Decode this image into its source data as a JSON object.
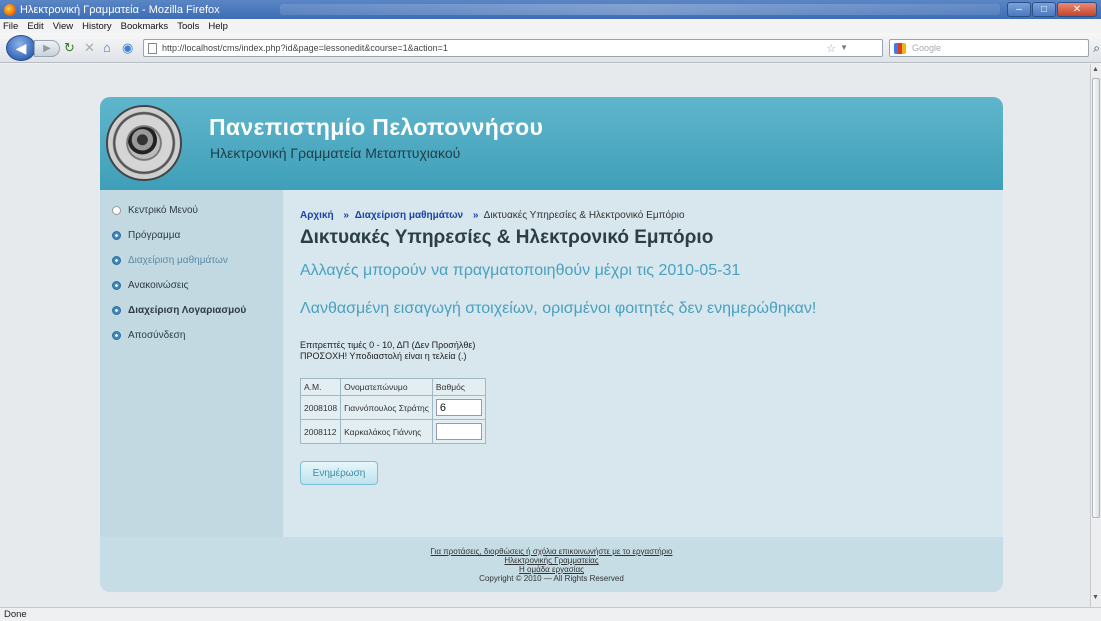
{
  "window": {
    "title": "Ηλεκτρονική Γραμματεία - Mozilla Firefox",
    "minimize": "–",
    "maximize": "□",
    "close": "✕"
  },
  "menu": [
    "File",
    "Edit",
    "View",
    "History",
    "Bookmarks",
    "Tools",
    "Help"
  ],
  "nav": {
    "back_icon": "back-arrow-icon",
    "back_glyph": "◀",
    "forward_glyph": "▶",
    "reload_glyph": "↻",
    "stop_glyph": "✕",
    "home_glyph": "⌂",
    "bookmark_glyph": "◉",
    "url": "http://localhost/cms/index.php?id&page=lessonedit&course=1&action=1",
    "search_placeholder": "Google"
  },
  "site": {
    "title": "Πανεπιστημίο Πελοποννήσου",
    "subtitle": "Ηλεκτρονική Γραμματεία Μεταπτυχιακού"
  },
  "sidebar": {
    "items": [
      {
        "label": "Κεντρικό Μενού"
      },
      {
        "label": "Πρόγραμμα"
      },
      {
        "label": "Διαχείριση μαθημάτων"
      },
      {
        "label": "Ανακοινώσεις"
      },
      {
        "label": "Διαχείριση Λογαριασμού"
      },
      {
        "label": "Αποσύνδεση"
      }
    ]
  },
  "breadcrumb": {
    "home": "Αρχική",
    "courses": "Διαχείριση μαθημάτων",
    "current": "Δικτυακές Υπηρεσίες & Ηλεκτρονικό Εμπόριο",
    "sep": "»"
  },
  "main": {
    "course_title": "Δικτυακές Υπηρεσίες & Ηλεκτρονικό Εμπόριο",
    "notice_deadline": "Αλλαγές μπορούν να πραγματοποιηθούν μέχρι τις 2010-05-31",
    "notice_error": "Λανθασμένη εισαγωγή στοιχείων, ορισμένοι φοιτητές δεν ενημερώθηκαν!",
    "info_line1": "Επιτρεπτές τιμές 0 - 10, ΔΠ (Δεν Προσήλθε)",
    "info_line2": "ΠΡΟΣΟΧΗ! Υποδιαστολή είναι η τελεία (.)",
    "submit": "Ενημέρωση"
  },
  "table": {
    "headers": [
      "Α.Μ.",
      "Ονοματεπώνυμο",
      "Βαθμός"
    ],
    "rows": [
      {
        "am": "2008108",
        "name": "Γιαννόπουλος Στράτης",
        "grade": "6"
      },
      {
        "am": "2008112",
        "name": "Καρκαλάκος Γιάννης",
        "grade": ""
      }
    ]
  },
  "footer": {
    "link1": "Για προτάσεις, διορθώσεις ή σχόλια επικοινωνήστε με το εργαστήριο",
    "link2": "Ηλεκτρονικής Γραμματείας",
    "link3": "Η ομάδα εργασίας",
    "copyright": "Copyright © 2010 — All Rights Reserved"
  },
  "statusbar": "Done"
}
